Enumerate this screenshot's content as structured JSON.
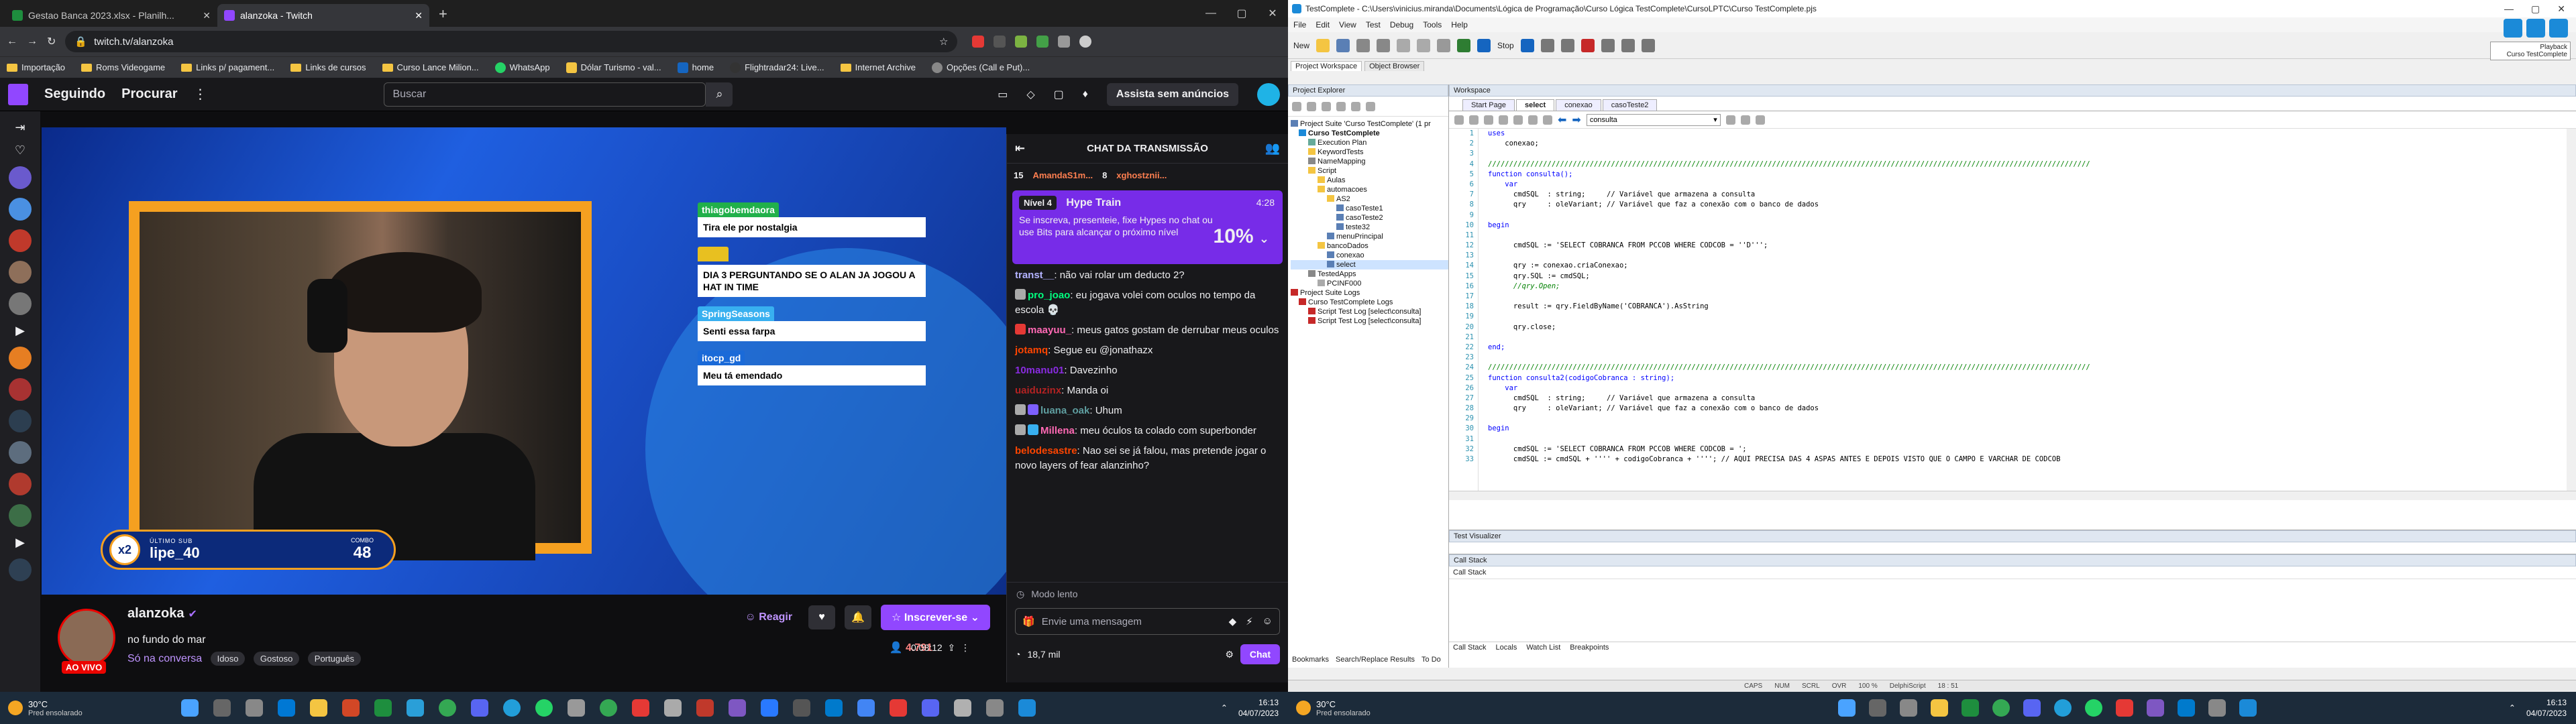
{
  "browser": {
    "tabs": [
      {
        "title": "Gestao Banca 2023.xlsx - Planilh...",
        "color": "#1e8e3e"
      },
      {
        "title": "alanzoka - Twitch",
        "color": "#9147ff"
      }
    ],
    "url": "twitch.tv/alanzoka",
    "bookmarks": [
      "Importação",
      "Roms Videogame",
      "Links p/ pagament...",
      "Links de cursos",
      "Curso Lance Milion...",
      "WhatsApp",
      "Dólar Turismo - val...",
      "home",
      "Flightradar24: Live...",
      "Internet Archive",
      "Opções (Call e Put)..."
    ]
  },
  "twitch": {
    "nav": {
      "following": "Seguindo",
      "browse": "Procurar",
      "search_placeholder": "Buscar",
      "prime": "Assista sem anúncios"
    },
    "overlay_chat": [
      {
        "user": "thiagobemdaora",
        "color": "#21b04a",
        "text": "Tira ele por nostalgia"
      },
      {
        "user": "",
        "color": "#e8c020",
        "text": "DIA 3 PERGUNTANDO SE O ALAN JA JOGOU A HAT IN TIME"
      },
      {
        "user": "SpringSeasons",
        "color": "#38b0f0",
        "text": "Senti essa farpa"
      },
      {
        "user": "itocp_gd",
        "color": "#1a6ad8",
        "text": "Meu tá emendado"
      }
    ],
    "last_sub": {
      "label": "ÚLTIMO SUB",
      "name": "lipe_40",
      "mult": "x2"
    },
    "combo": {
      "label": "COMBO",
      "value": "48"
    },
    "stream": {
      "channel": "alanzoka",
      "live": "AO VIVO",
      "title": "no fundo do mar",
      "category": "Só na conversa",
      "tags": [
        "Idoso",
        "Gostoso",
        "Português"
      ],
      "react": "Reagir",
      "subscribe": "Inscrever-se",
      "viewers": "4.791",
      "uptime": "0:08:12"
    },
    "chat": {
      "header": "CHAT DA TRANSMISSÃO",
      "gifts": [
        {
          "n": "15",
          "u": "AmandaS1m..."
        },
        {
          "n": "8",
          "u": "xghostznii..."
        }
      ],
      "hype": {
        "level": "Nível 4",
        "title": "Hype Train",
        "time": "4:28",
        "desc": "Se inscreva, presenteie, fixe Hypes no chat ou use Bits para alcançar o próximo nível",
        "pct": "10%"
      },
      "messages": [
        {
          "user": "transt__",
          "color": "#b3b3ff",
          "text": ": não vai rolar um deducto 2?"
        },
        {
          "user": "pro_joao",
          "color": "#00ff7f",
          "text": ": eu jogava volei com oculos no tempo da escola 💀"
        },
        {
          "user": "maayuu_",
          "color": "#ff69b4",
          "text": ": meus gatos gostam de derrubar meus oculos"
        },
        {
          "user": "jotamq",
          "color": "#ff4500",
          "text": ": Segue eu @jonathazx"
        },
        {
          "user": "10manu01",
          "color": "#8a2be2",
          "text": ": Davezinho"
        },
        {
          "user": "uaiduzinx",
          "color": "#b22222",
          "text": ": Manda oi"
        },
        {
          "user": "luana_oak",
          "color": "#5f9ea0",
          "text": ": Uhum"
        },
        {
          "user": "Millena",
          "color": "#ff69b4",
          "text": ": meu óculos ta colado com superbonder"
        },
        {
          "user": "belodesastre",
          "color": "#ff4500",
          "text": ": Nao sei se já falou, mas pretende jogar o novo layers of fear alanzinho?"
        }
      ],
      "slow": "Modo lento",
      "input_placeholder": "Envie uma mensagem",
      "points": "18,7 mil",
      "send": "Chat"
    }
  },
  "taskbar_left": {
    "temp": "30°C",
    "weather": "Pred ensolarado",
    "time": "16:13",
    "date": "04/07/2023"
  },
  "tc": {
    "title": "TestComplete - C:\\Users\\vinicius.miranda\\Documents\\Lógica de Programação\\Curso Lógica TestComplete\\CursoLPTC\\Curso TestComplete.pjs",
    "menu": [
      "File",
      "Edit",
      "View",
      "Test",
      "Debug",
      "Tools",
      "Help"
    ],
    "toolbar": {
      "new": "New",
      "stop": "Stop"
    },
    "panel_tabs": [
      "Project Workspace",
      "Object Browser"
    ],
    "project_explorer": "Project Explorer",
    "tree": [
      "Project Suite 'Curso TestComplete' (1 pr",
      "Curso TestComplete",
      "Execution Plan",
      "KeywordTests",
      "NameMapping",
      "Script",
      "Aulas",
      "automacoes",
      "AS2",
      "casoTeste1",
      "casoTeste2",
      "teste32",
      "menuPrincipal",
      "bancoDados",
      "conexao",
      "select",
      "TestedApps",
      "PCINF000",
      "Project Suite Logs",
      "Curso TestComplete Logs",
      "Script Test Log [select\\consulta]",
      "Script Test Log [select\\consulta]"
    ],
    "bottom_tabs": [
      "Bookmarks",
      "Search/Replace Results",
      "To Do"
    ],
    "workspace": "Workspace",
    "ws_tabs": [
      "Start Page",
      "select",
      "conexao",
      "casoTeste2"
    ],
    "routine": "consulta",
    "code": [
      "uses",
      "    conexao;",
      "",
      "//////////////////////////////////////////////////////////////////////////////////////////////////////////////////////////////////////////////",
      "function consulta();",
      "    var",
      "      cmdSQL  : string;     // Variável que armazena a consulta",
      "      qry     : oleVariant; // Variável que faz a conexão com o banco de dados",
      "",
      "begin",
      "",
      "      cmdSQL := 'SELECT COBRANCA FROM PCCOB WHERE CODCOB = ''D''';",
      "",
      "      qry := conexao.criaConexao;",
      "      qry.SQL := cmdSQL;",
      "      //qry.Open;",
      "",
      "      result := qry.FieldByName('COBRANCA').AsString",
      "",
      "      qry.close;",
      "",
      "end;",
      "",
      "//////////////////////////////////////////////////////////////////////////////////////////////////////////////////////////////////////////////",
      "function consulta2(codigoCobranca : string);",
      "    var",
      "      cmdSQL  : string;     // Variável que armazena a consulta",
      "      qry     : oleVariant; // Variável que faz a conexão com o banco de dados",
      "",
      "begin",
      "",
      "      cmdSQL := 'SELECT COBRANCA FROM PCCOB WHERE CODCOB = ';",
      "      cmdSQL := cmdSQL + '''' + codigoCobranca + ''''; // AQUI PRECISA DAS 4 ASPAS ANTES E DEPOIS VISTO QUE O CAMPO E VARCHAR DE CODCOB"
    ],
    "test_visualizer": "Test Visualizer",
    "call_stack_title": "Call Stack",
    "call_stack_col": "Call Stack",
    "debug_tabs": [
      "Call Stack",
      "Locals",
      "Watch List",
      "Breakpoints"
    ],
    "status": [
      "CAPS",
      "NUM",
      "SCRL",
      "OVR",
      "100 %",
      "DelphiScript",
      "18 : 51"
    ],
    "playback": "Playback",
    "popup": "Curso TestComplete"
  },
  "taskbar_right": {
    "temp": "30°C",
    "weather": "Pred ensolarado",
    "time": "16:13",
    "date": "04/07/2023"
  }
}
